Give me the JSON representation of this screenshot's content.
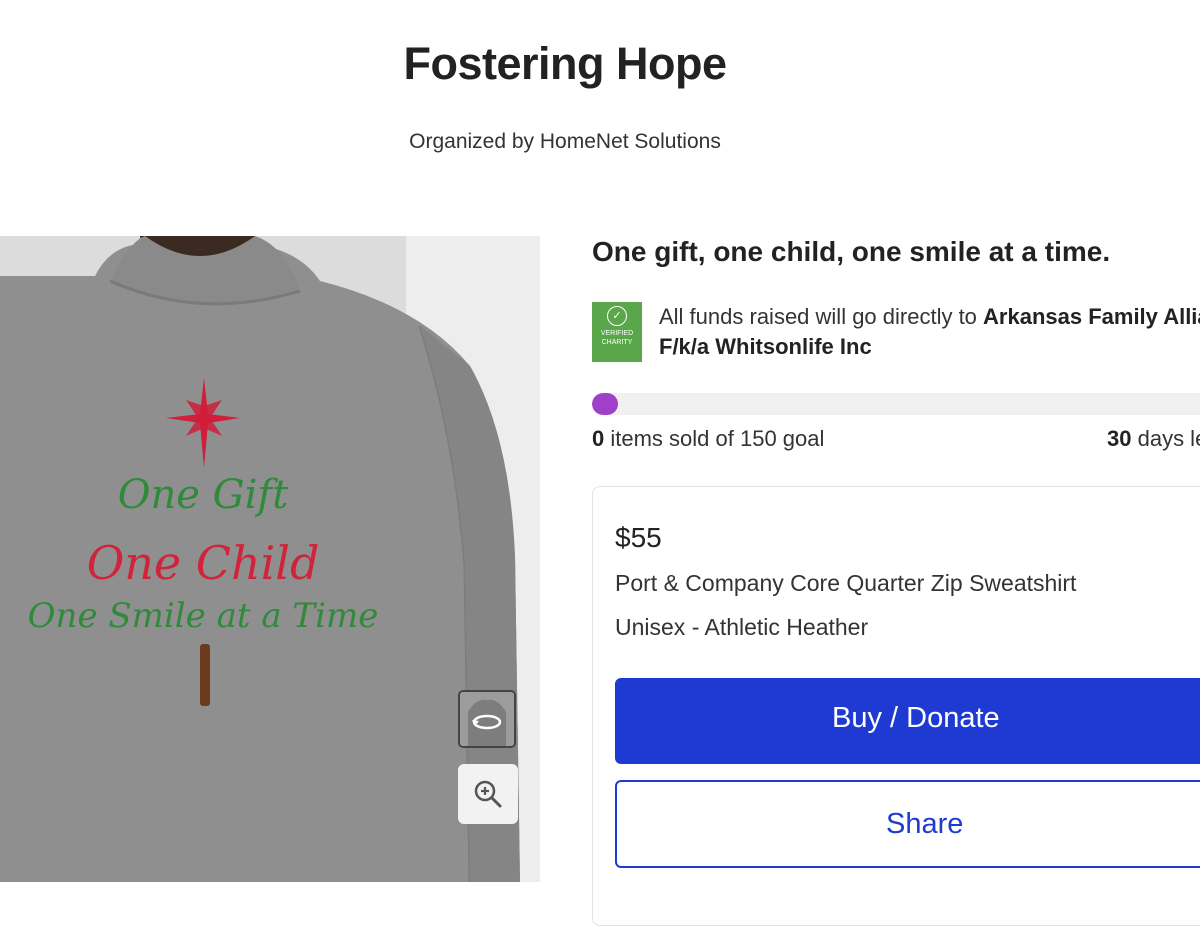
{
  "header": {
    "title": "Fostering Hope",
    "organizer": "Organized by HomeNet Solutions"
  },
  "product_image": {
    "print_line1": "One Gift",
    "print_line2": "One Child",
    "print_line3": "One Smile at a Time",
    "print_colors": {
      "green": "#2f8a3a",
      "red": "#d0243a",
      "star": "#d01f3a",
      "trunk": "#6b3a1f"
    },
    "thumbnail_icon": "rotate-icon",
    "zoom_icon": "zoom-in-icon"
  },
  "campaign": {
    "tagline": "One gift, one child, one smile at a time.",
    "badge_line1": "VERIFIED",
    "badge_line2": "CHARITY",
    "funds_prefix": "All funds raised will go directly to ",
    "charity_name": "Arkansas Family Alliance F/k/a Whitsonlife Inc",
    "progress_fraction": 0.0,
    "progress_color": "#a03fc8",
    "items_sold": "0",
    "sold_suffix": " items sold of 150 goal",
    "days_count": "30",
    "days_suffix": " days left"
  },
  "purchase": {
    "price": "$55",
    "product_name": "Port & Company Core Quarter Zip Sweatshirt",
    "variant": "Unisex - Athletic Heather",
    "buy_label": "Buy / Donate",
    "share_label": "Share",
    "accent_color": "#1f3ad2"
  }
}
